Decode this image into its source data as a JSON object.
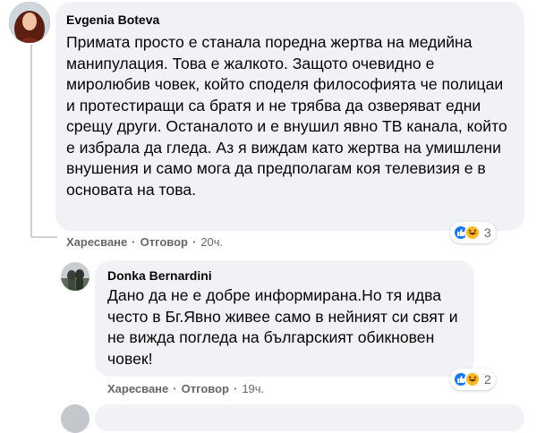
{
  "comments": [
    {
      "author": "Evgenia Boteva",
      "text": "Примата просто е станала поредна жертва на медийна манипулация. Това е жалкото. Защото очевидно е миролюбив човек, който споделя философията че полицаи и протестиращи са братя и не трябва да озверяват едни срещу други. Останалото и е внушил явно ТВ канала, който е избрала да гледа. Аз я виждам като жертва на умишлени внушения и само мога да предполагам коя телевизия е в основата на това.",
      "like_label": "Харесване",
      "reply_label": "Отговор",
      "time": "20ч.",
      "reaction_count": "3",
      "reaction_icons": [
        "like-icon",
        "haha-icon"
      ]
    },
    {
      "author": "Donka Bernardini",
      "text": "Дано да не е добре информирана.Но тя идва често в Бг.Явно живее само в нейният си свят и не вижда погледа на българският обикновен човек!",
      "like_label": "Харесване",
      "reply_label": "Отговор",
      "time": "19ч.",
      "reaction_count": "2",
      "reaction_icons": [
        "like-icon",
        "haha-icon"
      ]
    }
  ],
  "separator": "·",
  "colors": {
    "bubble": "#f0f2f5",
    "like_blue": "#1877f2",
    "haha_yellow": "#f7b928",
    "meta_gray": "#65676b"
  }
}
